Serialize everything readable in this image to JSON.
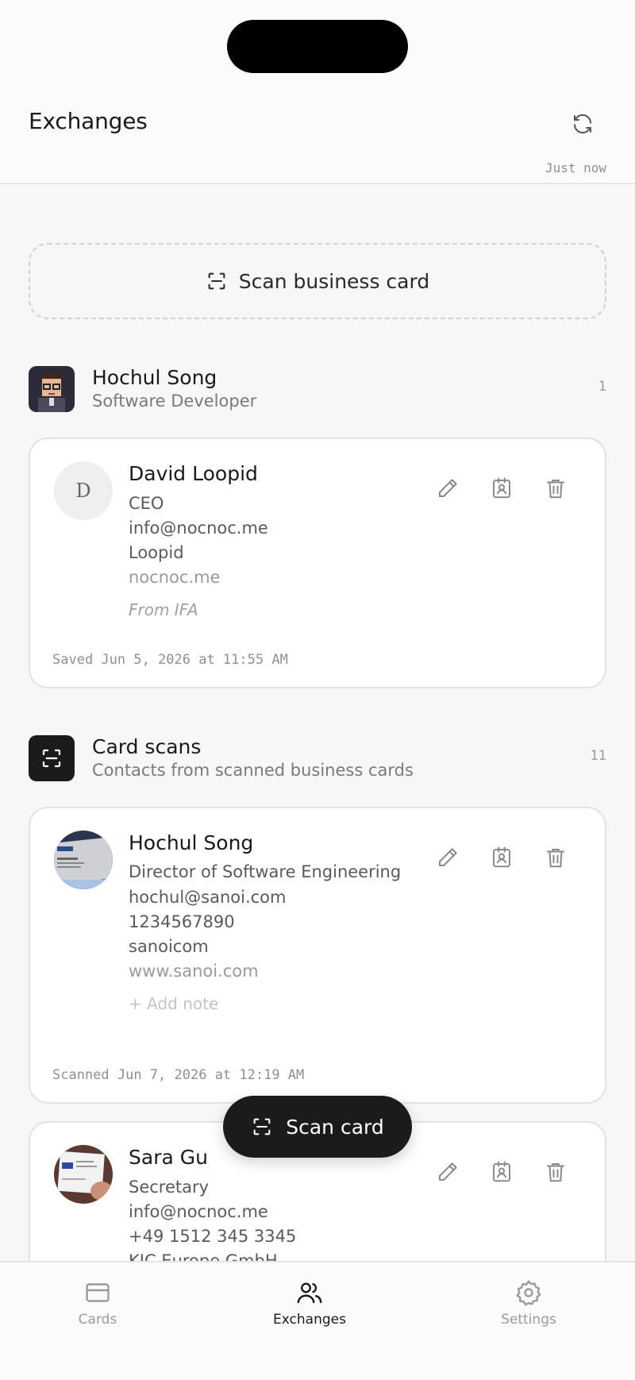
{
  "header": {
    "title": "Exchanges",
    "updated": "Just now",
    "refresh_icon": "refresh-icon"
  },
  "scan_box": {
    "label": "Scan business card",
    "icon": "scan-icon"
  },
  "groups": [
    {
      "name": "Hochul Song",
      "subtitle": "Software Developer",
      "count": "1",
      "contacts": [
        {
          "initial": "D",
          "name": "David Loopid",
          "lines": [
            "CEO",
            "info@nocnoc.me",
            "Loopid"
          ],
          "website": "nocnoc.me",
          "note": "From IFA",
          "footer": "Saved Jun 5, 2026 at 11:55 AM"
        }
      ]
    },
    {
      "name": "Card scans",
      "subtitle": "Contacts from scanned business cards",
      "count": "11",
      "contacts": [
        {
          "name": "Hochul Song",
          "lines": [
            "Director of Software Engineering",
            "hochul@sanoi.com",
            "1234567890",
            "sanoicom"
          ],
          "website": "www.sanoi.com",
          "note": "+ Add note",
          "footer": "Scanned Jun 7, 2026 at 12:19 AM"
        },
        {
          "name": "Sara Gu",
          "lines": [
            "Secretary",
            "info@nocnoc.me",
            "+49 1512 345 3345",
            "KIC Europe GmbH"
          ]
        }
      ]
    }
  ],
  "fab": {
    "label": "Scan card"
  },
  "nav": [
    {
      "label": "Cards",
      "icon": "card-icon",
      "active": false
    },
    {
      "label": "Exchanges",
      "icon": "people-icon",
      "active": true
    },
    {
      "label": "Settings",
      "icon": "gear-icon",
      "active": false
    }
  ],
  "colors": {
    "accent": "#1b1b1b",
    "background": "#f7f7f7",
    "card": "#ffffff"
  }
}
